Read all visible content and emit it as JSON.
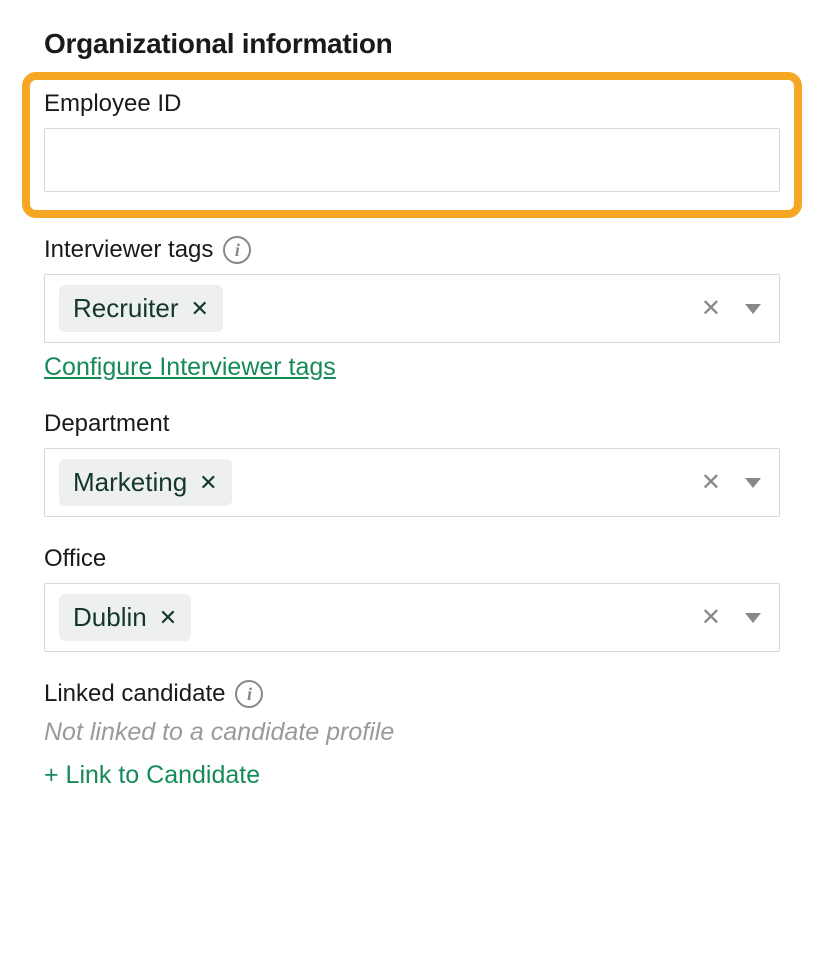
{
  "section_title": "Organizational information",
  "employee_id": {
    "label": "Employee ID",
    "value": ""
  },
  "interviewer_tags": {
    "label": "Interviewer tags",
    "chips": [
      "Recruiter"
    ],
    "configure_link": "Configure Interviewer tags"
  },
  "department": {
    "label": "Department",
    "chips": [
      "Marketing"
    ]
  },
  "office": {
    "label": "Office",
    "chips": [
      "Dublin"
    ]
  },
  "linked_candidate": {
    "label": "Linked candidate",
    "status_text": "Not linked to a candidate profile",
    "link_action": "+ Link to Candidate"
  }
}
